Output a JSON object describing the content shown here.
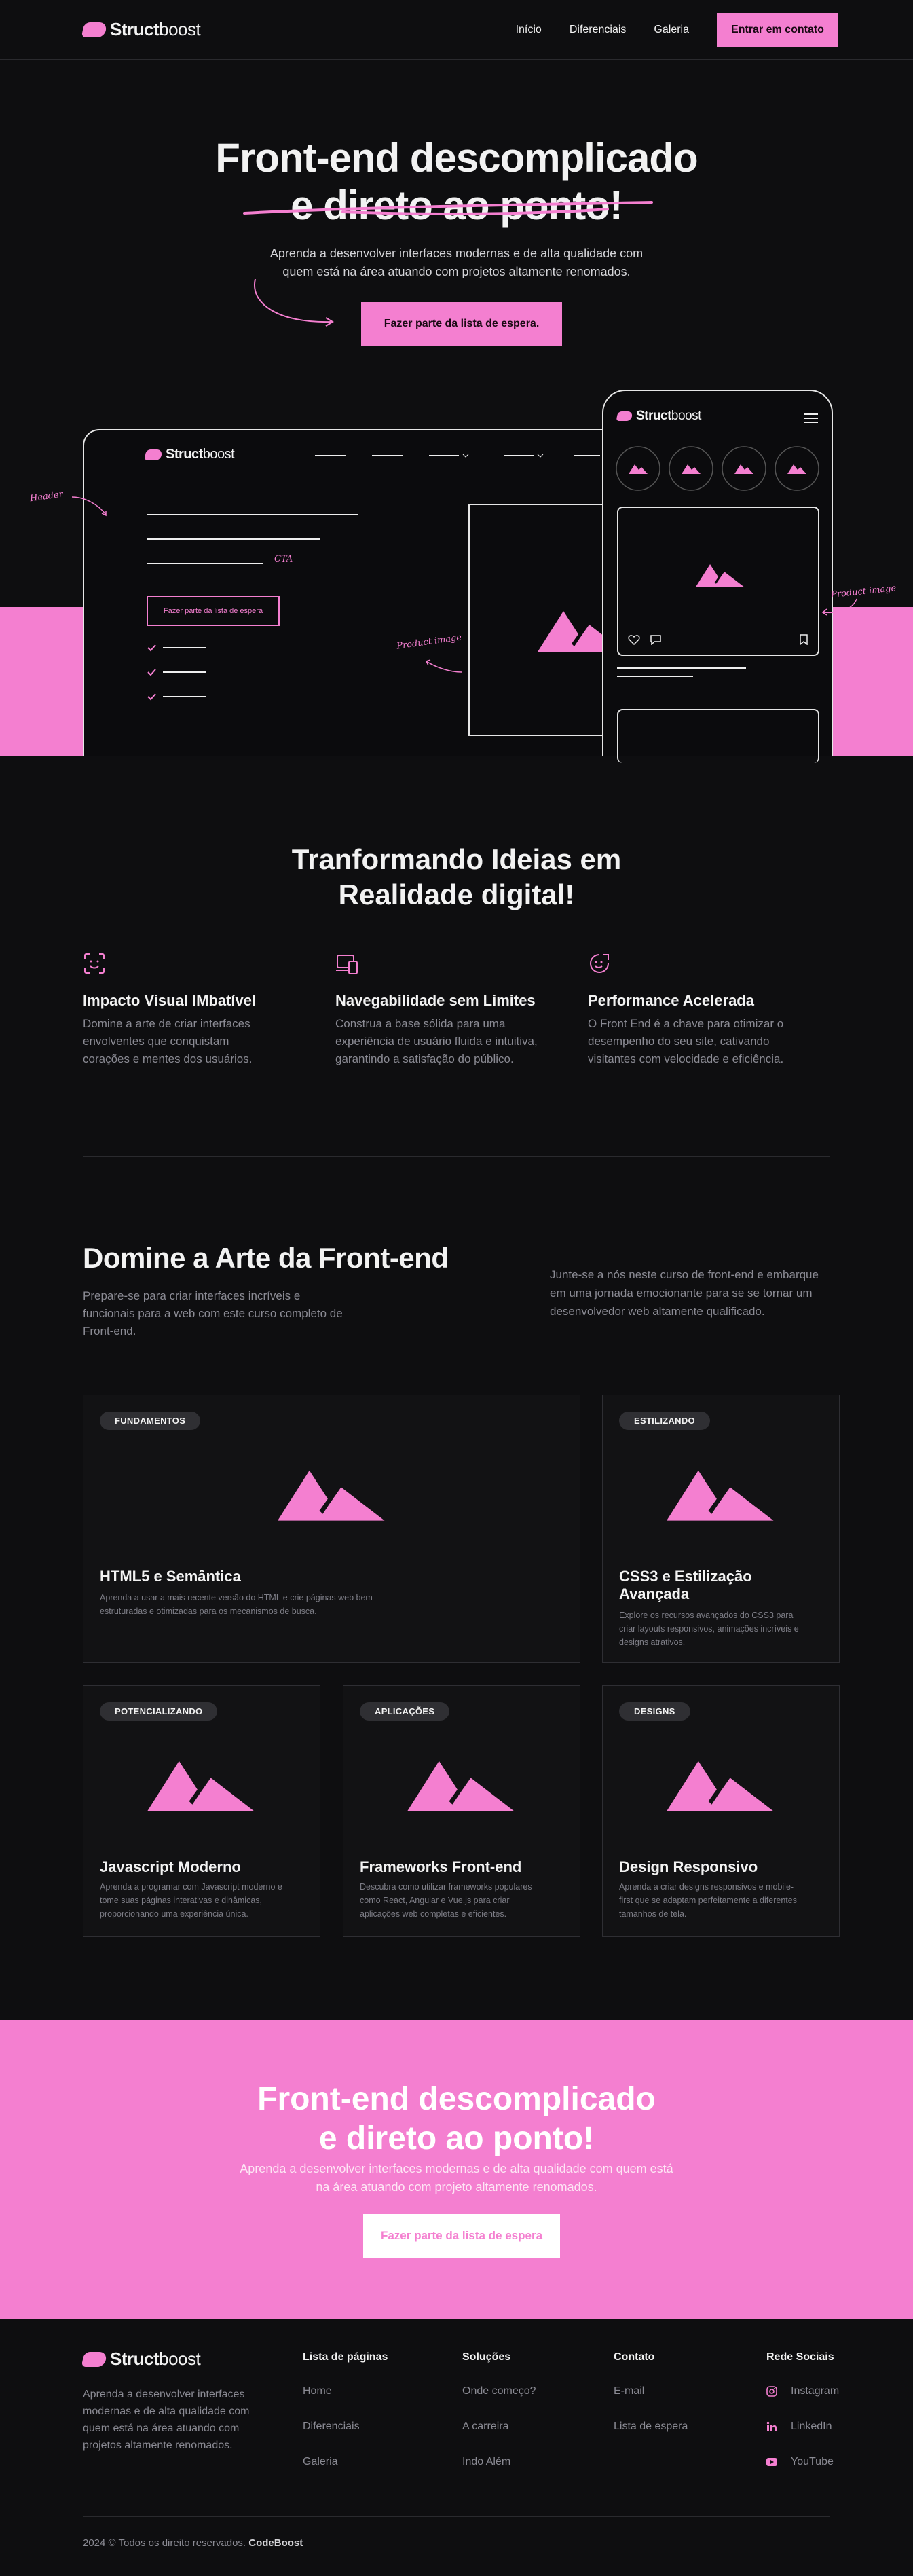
{
  "brand": {
    "bold": "Struct",
    "light": "boost",
    "accent": "#f47fd0",
    "background": "#0e0e10"
  },
  "nav": {
    "links": [
      "Início",
      "Diferenciais",
      "Galeria"
    ],
    "cta": "Entrar em contato"
  },
  "hero": {
    "title_line1": "Front-end descomplicado",
    "title_line2": "e direto ao ponto!",
    "subtitle_line1": "Aprenda a desenvolver interfaces modernas e de alta qualidade com",
    "subtitle_line2": "quem está na área atuando com projetos altamente renomados.",
    "cta": "Fazer parte da lista de espera."
  },
  "mockup": {
    "annotations": {
      "header": "Header",
      "product_image_left": "Product image",
      "product_image_right": "Product image",
      "cta": "CTA"
    },
    "cta_button": "Fazer parte da lista de espera"
  },
  "transform": {
    "title_line1": "Tranformando Ideias em",
    "title_line2": "Realidade digital!",
    "features": [
      {
        "icon": "face-scan-icon",
        "title": "Impacto Visual IMbatível",
        "lines": [
          "Domine a arte de criar interfaces",
          "envolventes que conquistam",
          "corações e mentes dos usuários."
        ]
      },
      {
        "icon": "devices-icon",
        "title": "Navegabilidade sem Limites",
        "lines": [
          "Construa a base sólida para uma",
          "experiência de usuário fluida e intuitiva,",
          "garantindo a satisfação do público."
        ]
      },
      {
        "icon": "speed-emoji-icon",
        "title": "Performance Acelerada",
        "lines": [
          "O Front End é a chave para otimizar o",
          "desempenho do seu site, cativando",
          "visitantes com velocidade e eficiência."
        ]
      }
    ]
  },
  "domine": {
    "title": "Domine a Arte da Front-end",
    "lead_lines": [
      "Prepare-se para criar interfaces incríveis e",
      "funcionais para a web com este curso completo de",
      "Front-end."
    ],
    "side_lines": [
      "Junte-se a nós neste curso de front-end e embarque",
      "em uma jornada emocionante para se se tornar um",
      "desenvolvedor web altamente qualificado."
    ],
    "cards": [
      {
        "badge": "FUNDAMENTOS",
        "title": "HTML5 e Semântica",
        "lines": [
          "Aprenda a usar a mais recente versão do HTML e crie páginas web bem",
          "estruturadas e otimizadas para os mecanismos de busca."
        ]
      },
      {
        "badge": "ESTILIZANDO",
        "title_lines": [
          "CSS3 e Estilização",
          "Avançada"
        ],
        "lines": [
          "Explore os recursos avançados do CSS3 para",
          "criar layouts responsivos, animações incríveis e",
          "designs atrativos."
        ]
      },
      {
        "badge": "POTENCIALIZANDO",
        "title": "Javascript Moderno",
        "lines": [
          "Aprenda a programar com Javascript moderno e",
          "tome suas páginas interativas e dinâmicas,",
          "proporcionando uma experiência única."
        ]
      },
      {
        "badge": "APLICAÇÕES",
        "title": "Frameworks Front-end",
        "lines": [
          "Descubra como utilizar frameworks populares",
          "como React, Angular e Vue.js para criar",
          "aplicações web completas e eficientes."
        ]
      },
      {
        "badge": "DESIGNS",
        "title": "Design Responsivo",
        "lines": [
          "Aprenda a criar designs responsivos e mobile-",
          "first que se adaptam perfeitamente a diferentes",
          "tamanhos de tela."
        ]
      }
    ]
  },
  "band": {
    "title_line1": "Front-end descomplicado",
    "title_line2": "e direto ao ponto!",
    "subtitle_line1": "Aprenda a desenvolver interfaces modernas e de alta qualidade com quem está",
    "subtitle_line2": "na área atuando com projeto altamente renomados.",
    "cta": "Fazer parte da lista de espera"
  },
  "footer": {
    "about_lines": [
      "Aprenda a desenvolver interfaces",
      "modernas e de alta qualidade com",
      "quem está na área atuando com",
      "projetos altamente renomados."
    ],
    "columns": [
      {
        "title": "Lista de páginas",
        "links": [
          "Home",
          "Diferenciais",
          "Galeria"
        ]
      },
      {
        "title": "Soluções",
        "links": [
          "Onde começo?",
          "A carreira",
          "Indo Além"
        ]
      },
      {
        "title": "Contato",
        "links": [
          "E-mail",
          "Lista de espera"
        ]
      },
      {
        "title": "Rede Sociais",
        "links": [
          "Instagram",
          "LinkedIn",
          "YouTube"
        ],
        "icons": [
          "instagram-icon",
          "linkedin-icon",
          "youtube-icon"
        ]
      }
    ],
    "copyright": "2024 © Todos os direito reservados.",
    "company": "CodeBoost"
  }
}
